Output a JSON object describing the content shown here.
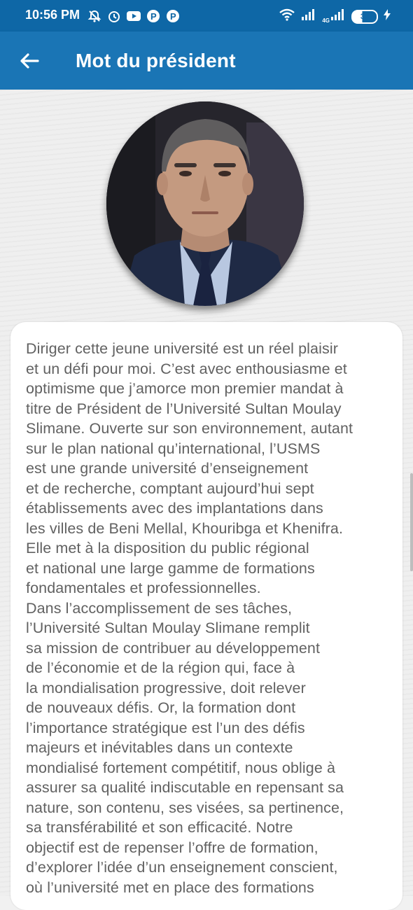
{
  "status": {
    "time": "10:56 PM",
    "network": "4G",
    "battery": "39"
  },
  "appbar": {
    "title": "Mot du président"
  },
  "icons": {
    "back": "arrow-left-icon",
    "mute": "bell-off-icon",
    "alarm": "alarm-icon",
    "youtube": "youtube-icon",
    "p1": "p-icon",
    "p2": "p-icon"
  },
  "main": {
    "photo_alt": "president-photo",
    "message": "Diriger cette jeune université est un réel plaisir\net un défi pour moi. C’est avec enthousiasme et\noptimisme que j’amorce mon premier mandat à\ntitre de Président de l’Université Sultan Moulay\nSlimane. Ouverte sur son environnement, autant\nsur le plan national qu’international, l’USMS\nest une grande université d’enseignement\net de recherche, comptant aujourd’hui sept\nétablissements avec des implantations dans\nles villes de Beni Mellal, Khouribga et Khenifra.\nElle met à la disposition du public régional\net national une large gamme de formations\nfondamentales et professionnelles.\nDans l’accomplissement de ses tâches,\nl’Université Sultan Moulay Slimane remplit\nsa mission de contribuer au développement\nde l’économie et de la région qui, face à\nla mondialisation progressive, doit relever\nde nouveaux défis. Or, la formation dont\nl’importance stratégique est l’un des défis\nmajeurs et inévitables dans un contexte\nmondialisé fortement compétitif, nous oblige à\nassurer sa qualité indiscutable en repensant sa\nnature, son contenu, ses visées, sa pertinence,\nsa transférabilité et son efficacité. Notre\nobjectif est de repenser l’offre de formation,\nd’explorer l’idée d’un enseignement conscient,\noù l’université met en place des formations"
  }
}
